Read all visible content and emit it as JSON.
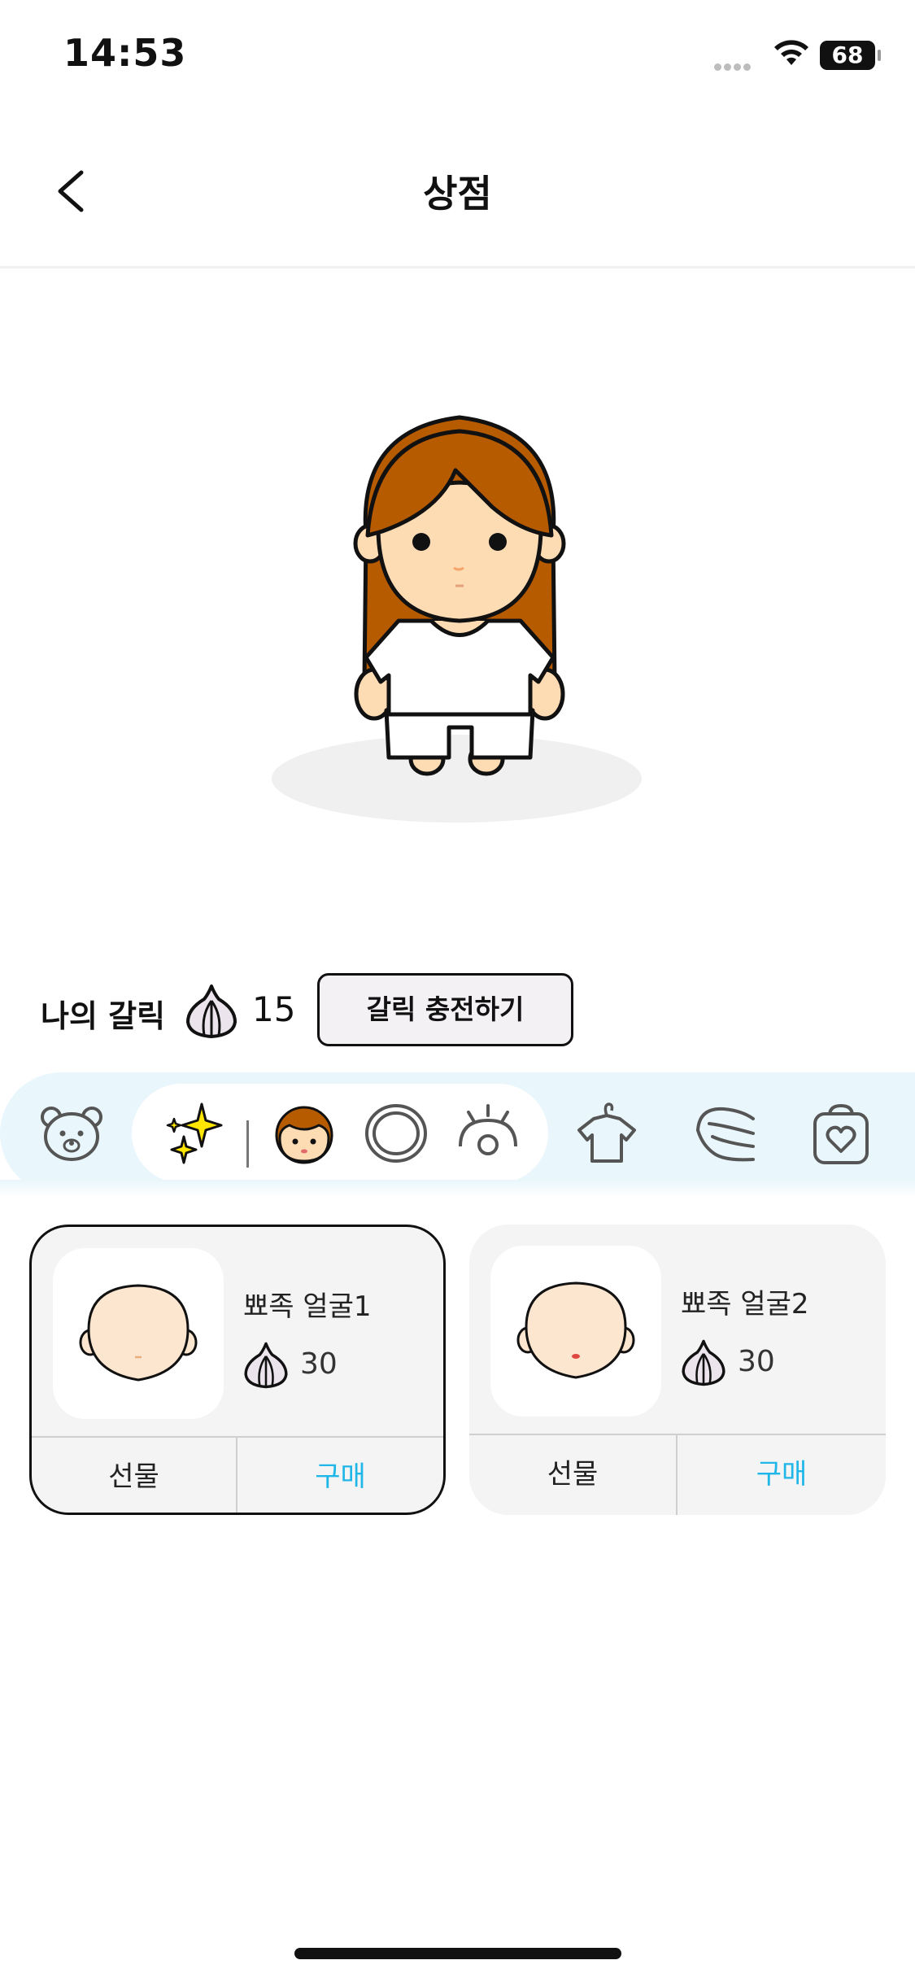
{
  "status_bar": {
    "time": "14:53",
    "battery": "68"
  },
  "header": {
    "title": "상점",
    "back_icon": "chevron-left-icon"
  },
  "garlic": {
    "label": "나의 갈릭",
    "count": "15",
    "charge_label": "갈릭 충전하기",
    "icon": "garlic-icon"
  },
  "categories": [
    {
      "name": "bear",
      "icon": "bear-icon",
      "active": false
    },
    {
      "name": "sparkle",
      "icon": "sparkle-icon",
      "active": true
    },
    {
      "name": "face",
      "icon": "face-icon",
      "active": true
    },
    {
      "name": "ring",
      "icon": "ring-icon",
      "active": true
    },
    {
      "name": "eye",
      "icon": "eye-icon",
      "active": true
    },
    {
      "name": "clothes",
      "icon": "shirt-hanger-icon",
      "active": false
    },
    {
      "name": "hair",
      "icon": "hair-icon",
      "active": false
    },
    {
      "name": "bag",
      "icon": "heart-bag-icon",
      "active": false
    }
  ],
  "items": [
    {
      "name": "뾰족 얼굴1",
      "price": "30",
      "gift_label": "선물",
      "buy_label": "구매",
      "selected": true
    },
    {
      "name": "뾰족 얼굴2",
      "price": "30",
      "gift_label": "선물",
      "buy_label": "구매",
      "selected": false
    }
  ],
  "colors": {
    "accent_blue": "#1fb6e8",
    "category_bg": "#e9f6fc",
    "hair_brown": "#b65b00",
    "skin": "#fddcb4",
    "card_bg": "#f4f4f4"
  }
}
